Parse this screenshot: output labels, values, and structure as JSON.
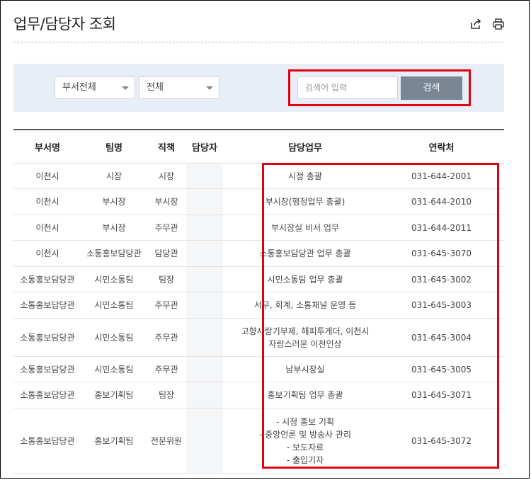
{
  "page": {
    "title": "업무/담당자 조회"
  },
  "icons": {
    "share": "share-icon",
    "print": "print-icon"
  },
  "filters": {
    "department": "부서전체",
    "team": "전체",
    "search_placeholder": "검색어 입력",
    "search_button": "검색"
  },
  "colors": {
    "highlight": "#e0000f",
    "search_bg": "#e8eef6",
    "button_bg": "#7b8694"
  },
  "table": {
    "headers": [
      "부서명",
      "팀명",
      "직책",
      "담당자",
      "담당업무",
      "연락처"
    ],
    "rows": [
      {
        "dept": "이천시",
        "team": "시장",
        "position": "시장",
        "duty": "시정 총괄",
        "phone": "031-644-2001"
      },
      {
        "dept": "이천시",
        "team": "부시장",
        "position": "부시장",
        "duty": "부시장(행정업무 총괄)",
        "phone": "031-644-2010"
      },
      {
        "dept": "이천시",
        "team": "부시장",
        "position": "주무관",
        "duty": "부시장실 비서 업무",
        "phone": "031-644-2011"
      },
      {
        "dept": "이천시",
        "team": "소통홍보담당관",
        "position": "담당관",
        "duty": "소통홍보담당관 업무 총괄",
        "phone": "031-645-3070"
      },
      {
        "dept": "소통홍보담당관",
        "team": "시민소통팀",
        "position": "팀장",
        "duty": "시민소통팀 업무 총괄",
        "phone": "031-645-3002"
      },
      {
        "dept": "소통홍보담당관",
        "team": "시민소통팀",
        "position": "주무관",
        "duty": "서무, 회계, 소통채널 운영 등",
        "phone": "031-645-3003"
      },
      {
        "dept": "소통홍보담당관",
        "team": "시민소통팀",
        "position": "주무관",
        "duty": "고향사랑기부제, 해피투게더, 이천시\n자랑스러운 이천인상",
        "phone": "031-645-3004"
      },
      {
        "dept": "소통홍보담당관",
        "team": "시민소통팀",
        "position": "주무관",
        "duty": "남부시장실",
        "phone": "031-645-3005"
      },
      {
        "dept": "소통홍보담당관",
        "team": "홍보기획팀",
        "position": "팀장",
        "duty": "홍보기획팀 업무 총괄",
        "phone": "031-645-3071"
      },
      {
        "dept": "소통홍보담당관",
        "team": "홍보기획팀",
        "position": "전문위원",
        "duty": "- 시정 홍보 기획\n- 중앙언론 및 방송사 관리\n- 보도자료\n- 출입기자",
        "phone": "031-645-3072"
      }
    ]
  }
}
